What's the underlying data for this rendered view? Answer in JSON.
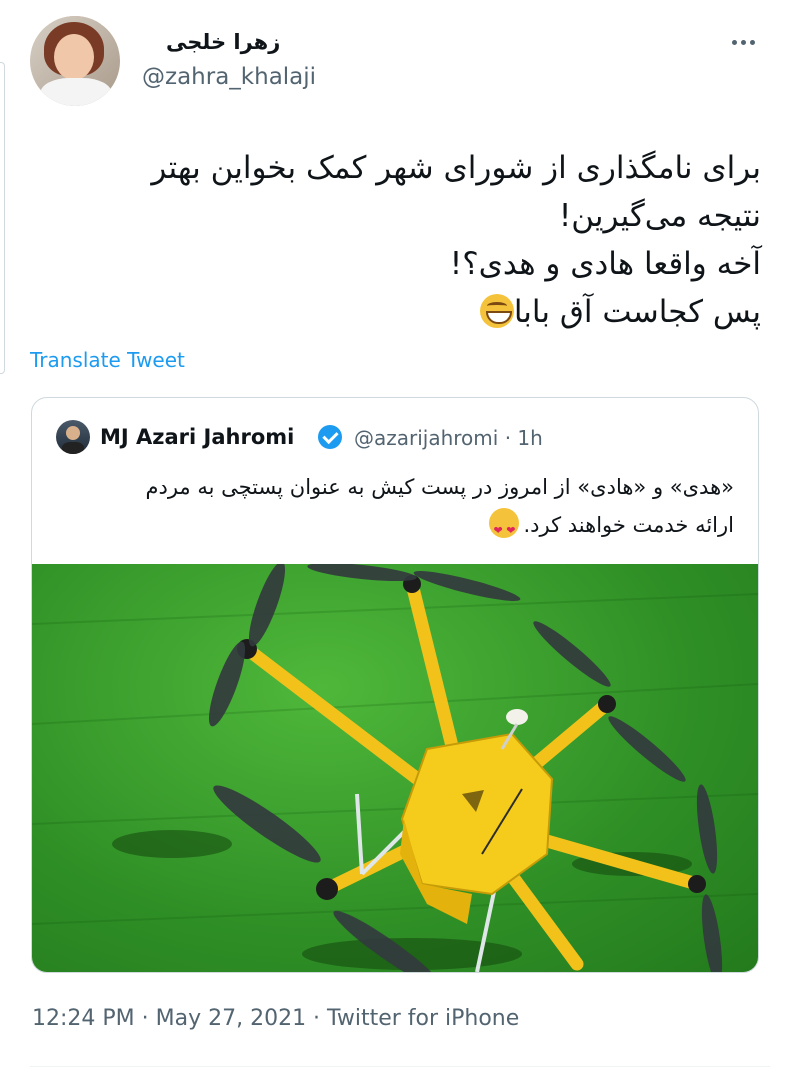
{
  "author": {
    "display_name": "زهرا خلجی",
    "handle": "@zahra_khalaji"
  },
  "tweet": {
    "lines": [
      "برای نامگذاری از شورای شهر کمک بخواین بهتر",
      "نتیجه می‌گیرین!",
      "آخه واقعا هادی و هدی؟!",
      "پس کجاست آق بابا"
    ],
    "emoji": "grinning-face-with-smiling-eyes"
  },
  "translate_label": "Translate Tweet",
  "quoted": {
    "name": "MJ Azari Jahromi",
    "verified": true,
    "handle_time": "@azarijahromi · 1h",
    "lines": [
      "«هدی» و «هادی» از امروز در پست کیش به عنوان پستچی به مردم",
      "ارائه خدمت خواهند کرد."
    ],
    "emoji": "smiling-face-with-heart-eyes",
    "image": "yellow-delivery-drone-on-grass"
  },
  "meta": {
    "timestamp": "12:24 PM · May 27, 2021 · Twitter for iPhone"
  },
  "colors": {
    "link": "#1d9bf0",
    "secondary_text": "#536471",
    "border": "#cfd9de"
  }
}
